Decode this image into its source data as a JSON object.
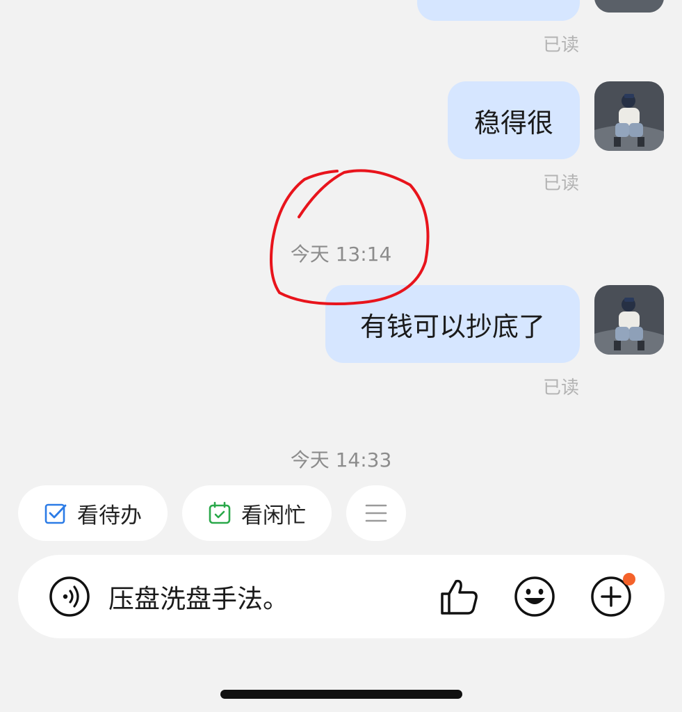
{
  "messages": [
    {
      "text": "",
      "status": "已读"
    },
    {
      "text": "稳得很",
      "status": "已读"
    },
    {
      "text": "有钱可以抄底了",
      "status": "已读"
    }
  ],
  "timestamps": [
    "今天 13:14",
    "今天 14:33"
  ],
  "quick_actions": [
    {
      "label": "看待办",
      "icon": "checkbox-icon",
      "color": "#2b7be6"
    },
    {
      "label": "看闲忙",
      "icon": "calendar-check-icon",
      "color": "#2aa84a"
    },
    {
      "label": "",
      "icon": "menu-icon"
    }
  ],
  "composer": {
    "text": "压盘洗盘手法。",
    "icons": [
      "voice-icon",
      "thumbs-up-icon",
      "emoji-icon",
      "plus-icon"
    ],
    "notification_dot_color": "#f4622a"
  },
  "colors": {
    "background": "#f2f2f2",
    "bubble": "#d6e6ff",
    "annotation": "#e8141c"
  }
}
